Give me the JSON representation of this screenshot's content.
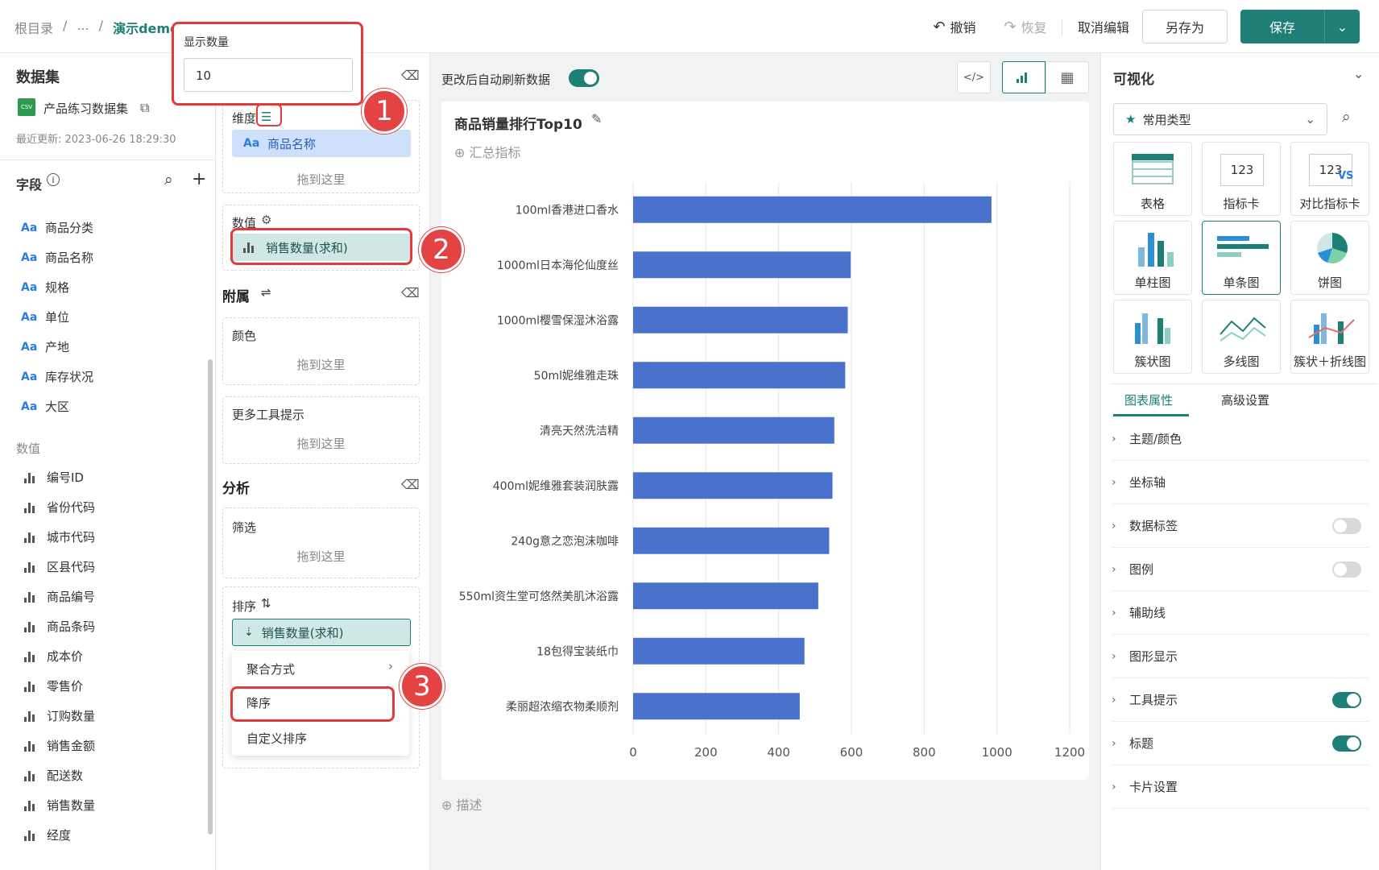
{
  "breadcrumb": {
    "root": "根目录",
    "sep1": "/",
    "ellipsis": "...",
    "sep2": "/",
    "current": "演示demo"
  },
  "toolbar": {
    "undo": "撤销",
    "redo": "恢复",
    "cancel_edit": "取消编辑",
    "save_as": "另存为",
    "save": "保存"
  },
  "display_count": {
    "label": "显示数量",
    "value": "10"
  },
  "dataset": {
    "title": "数据集",
    "name": "产品练习数据集",
    "updated": "最近更新: 2023-06-26 18:29:30",
    "file_badge": "CSV"
  },
  "fields": {
    "title": "字段",
    "dims": [
      "商品分类",
      "商品名称",
      "规格",
      "单位",
      "产地",
      "库存状况",
      "大区"
    ],
    "dim_icon": "Aa",
    "measures_title": "数值",
    "measures": [
      "编号ID",
      "省份代码",
      "城市代码",
      "区县代码",
      "商品编号",
      "商品条码",
      "成本价",
      "零售价",
      "订购数量",
      "销售金额",
      "配送数",
      "销售数量",
      "经度"
    ]
  },
  "config": {
    "dimension_label": "维度",
    "dimension_chip": "商品名称",
    "drop_here": "拖到这里",
    "value_label": "数值",
    "value_chip": "销售数量(求和)",
    "attach_title": "附属",
    "color_label": "颜色",
    "tooltip_label": "更多工具提示",
    "analysis_title": "分析",
    "filter_label": "筛选",
    "sort_label": "排序",
    "sort_chip": "销售数量(求和)",
    "menu": [
      "聚合方式",
      "降序",
      "自定义排序"
    ]
  },
  "canvas": {
    "auto_refresh": "更改后自动刷新数据",
    "auto_refresh_on": true,
    "summary": "汇总指标",
    "describe": "描述"
  },
  "chart_data": {
    "type": "bar",
    "orientation": "horizontal",
    "title": "商品销量排行Top10",
    "categories": [
      "100ml香港进口香水",
      "1000ml日本海伦仙度丝",
      "1000ml樱雪保湿沐浴露",
      "50ml妮维雅走珠",
      "清亮天然洗洁精",
      "400ml妮维雅套装润肤露",
      "240g意之恋泡沫咖啡",
      "550ml资生堂可悠然美肌沐浴露",
      "18包得宝装纸巾",
      "柔丽超浓缩衣物柔顺剂"
    ],
    "values": [
      985,
      598,
      590,
      583,
      553,
      548,
      539,
      509,
      471,
      458
    ],
    "xlim": [
      0,
      1200
    ],
    "xticks": [
      0,
      200,
      400,
      600,
      800,
      1000,
      1200
    ],
    "color": "#4a72cc",
    "grid": true
  },
  "viz": {
    "title": "可视化",
    "type_select": "常用类型",
    "types": [
      "表格",
      "指标卡",
      "对比指标卡",
      "单柱图",
      "单条图",
      "饼图",
      "簇状图",
      "多线图",
      "簇状＋折线图"
    ],
    "kpi_text": "123",
    "vs_text": "VS",
    "tabs": [
      "图表属性",
      "高级设置"
    ],
    "props": [
      {
        "label": "主题/颜色",
        "toggle": null
      },
      {
        "label": "坐标轴",
        "toggle": null
      },
      {
        "label": "数据标签",
        "toggle": false
      },
      {
        "label": "图例",
        "toggle": false
      },
      {
        "label": "辅助线",
        "toggle": null
      },
      {
        "label": "图形显示",
        "toggle": null
      },
      {
        "label": "工具提示",
        "toggle": true
      },
      {
        "label": "标题",
        "toggle": true
      },
      {
        "label": "卡片设置",
        "toggle": null
      }
    ]
  },
  "badges": [
    "1",
    "2",
    "3"
  ],
  "colors": {
    "accent": "#1d7f76",
    "bar": "#4a72cc",
    "annotation": "#e23b3b",
    "chip_dim": "#cfe0fb",
    "chip_val": "#cfe8e5"
  }
}
